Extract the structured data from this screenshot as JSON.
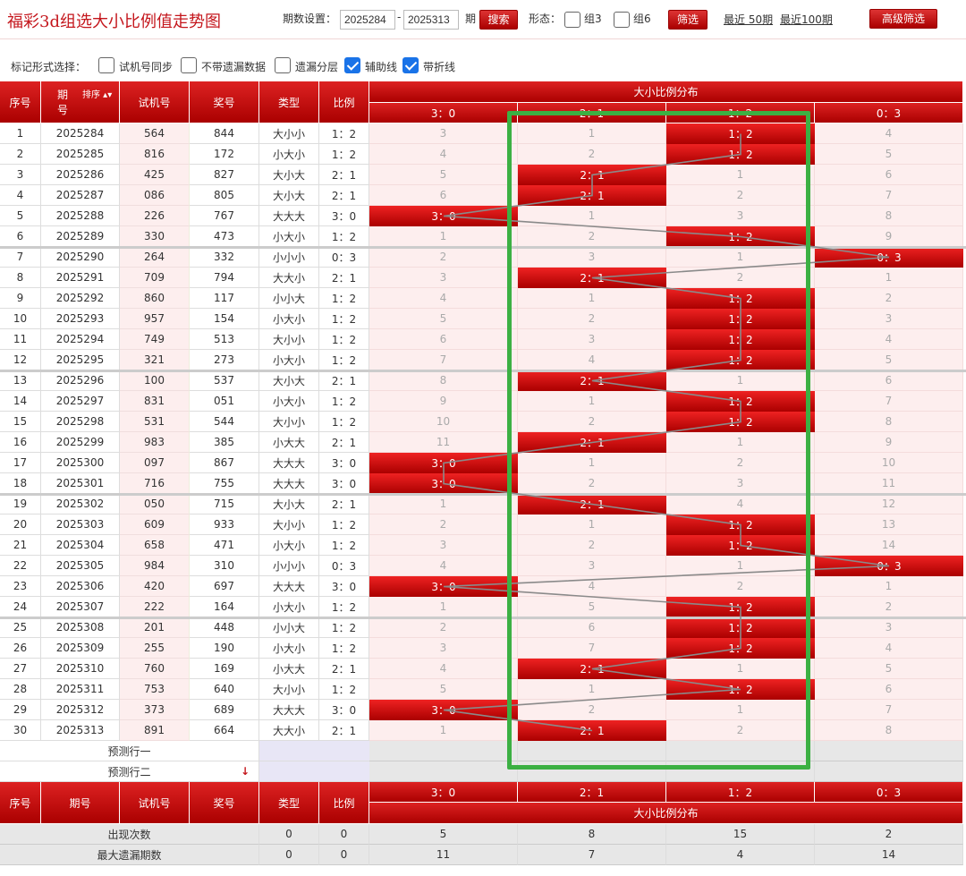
{
  "header": {
    "title": "福彩3d组选大小比例值走势图",
    "period_label": "期数设置：",
    "period_from": "2025284",
    "period_to": "2025313",
    "period_suffix": "期",
    "search_label": "搜索",
    "form_label": "形态：",
    "group3_label": "组3",
    "group6_label": "组6",
    "filter_label": "筛选",
    "recent50": "最近 50期",
    "recent100": "最近100期",
    "advanced_filter": "高级筛选"
  },
  "options": {
    "label": "标记形式选择：",
    "items": [
      {
        "label": "试机号同步",
        "checked": false
      },
      {
        "label": "不带遗漏数据",
        "checked": false
      },
      {
        "label": "遗漏分层",
        "checked": false
      },
      {
        "label": "辅助线",
        "checked": true
      },
      {
        "label": "带折线",
        "checked": true
      }
    ]
  },
  "table": {
    "headers": {
      "seq": "序号",
      "period_top": "期",
      "period_bottom": "号",
      "sort": "排序",
      "test_no": "试机号",
      "prize_no": "奖号",
      "type": "类型",
      "ratio": "比例",
      "group": "大小比例分布"
    },
    "ratio_columns": [
      "3：0",
      "2：1",
      "1：2",
      "0：3"
    ],
    "rows": [
      {
        "seq": "1",
        "period": "2025284",
        "test": "564",
        "prize": "844",
        "type": "大小小",
        "ratio": "1：2",
        "hit": 2,
        "miss": [
          "3",
          "1",
          "1：2",
          "4"
        ]
      },
      {
        "seq": "2",
        "period": "2025285",
        "test": "816",
        "prize": "172",
        "type": "小大小",
        "ratio": "1：2",
        "hit": 2,
        "miss": [
          "4",
          "2",
          "1：2",
          "5"
        ]
      },
      {
        "seq": "3",
        "period": "2025286",
        "test": "425",
        "prize": "827",
        "type": "大小大",
        "ratio": "2：1",
        "hit": 1,
        "miss": [
          "5",
          "2：1",
          "1",
          "6"
        ]
      },
      {
        "seq": "4",
        "period": "2025287",
        "test": "086",
        "prize": "805",
        "type": "大小大",
        "ratio": "2：1",
        "hit": 1,
        "miss": [
          "6",
          "2：1",
          "2",
          "7"
        ]
      },
      {
        "seq": "5",
        "period": "2025288",
        "test": "226",
        "prize": "767",
        "type": "大大大",
        "ratio": "3：0",
        "hit": 0,
        "miss": [
          "3：0",
          "1",
          "3",
          "8"
        ]
      },
      {
        "seq": "6",
        "period": "2025289",
        "test": "330",
        "prize": "473",
        "type": "小大小",
        "ratio": "1：2",
        "hit": 2,
        "miss": [
          "1",
          "2",
          "1：2",
          "9"
        ]
      },
      {
        "seq": "7",
        "period": "2025290",
        "test": "264",
        "prize": "332",
        "type": "小小小",
        "ratio": "0：3",
        "hit": 3,
        "miss": [
          "2",
          "3",
          "1",
          "0：3"
        ]
      },
      {
        "seq": "8",
        "period": "2025291",
        "test": "709",
        "prize": "794",
        "type": "大大小",
        "ratio": "2：1",
        "hit": 1,
        "miss": [
          "3",
          "2：1",
          "2",
          "1"
        ]
      },
      {
        "seq": "9",
        "period": "2025292",
        "test": "860",
        "prize": "117",
        "type": "小小大",
        "ratio": "1：2",
        "hit": 2,
        "miss": [
          "4",
          "1",
          "1：2",
          "2"
        ]
      },
      {
        "seq": "10",
        "period": "2025293",
        "test": "957",
        "prize": "154",
        "type": "小大小",
        "ratio": "1：2",
        "hit": 2,
        "miss": [
          "5",
          "2",
          "1：2",
          "3"
        ]
      },
      {
        "seq": "11",
        "period": "2025294",
        "test": "749",
        "prize": "513",
        "type": "大小小",
        "ratio": "1：2",
        "hit": 2,
        "miss": [
          "6",
          "3",
          "1：2",
          "4"
        ]
      },
      {
        "seq": "12",
        "period": "2025295",
        "test": "321",
        "prize": "273",
        "type": "小大小",
        "ratio": "1：2",
        "hit": 2,
        "miss": [
          "7",
          "4",
          "1：2",
          "5"
        ]
      },
      {
        "seq": "13",
        "period": "2025296",
        "test": "100",
        "prize": "537",
        "type": "大小大",
        "ratio": "2：1",
        "hit": 1,
        "miss": [
          "8",
          "2：1",
          "1",
          "6"
        ]
      },
      {
        "seq": "14",
        "period": "2025297",
        "test": "831",
        "prize": "051",
        "type": "小大小",
        "ratio": "1：2",
        "hit": 2,
        "miss": [
          "9",
          "1",
          "1：2",
          "7"
        ]
      },
      {
        "seq": "15",
        "period": "2025298",
        "test": "531",
        "prize": "544",
        "type": "大小小",
        "ratio": "1：2",
        "hit": 2,
        "miss": [
          "10",
          "2",
          "1：2",
          "8"
        ]
      },
      {
        "seq": "16",
        "period": "2025299",
        "test": "983",
        "prize": "385",
        "type": "小大大",
        "ratio": "2：1",
        "hit": 1,
        "miss": [
          "11",
          "2：1",
          "1",
          "9"
        ]
      },
      {
        "seq": "17",
        "period": "2025300",
        "test": "097",
        "prize": "867",
        "type": "大大大",
        "ratio": "3：0",
        "hit": 0,
        "miss": [
          "3：0",
          "1",
          "2",
          "10"
        ]
      },
      {
        "seq": "18",
        "period": "2025301",
        "test": "716",
        "prize": "755",
        "type": "大大大",
        "ratio": "3：0",
        "hit": 0,
        "miss": [
          "3：0",
          "2",
          "3",
          "11"
        ]
      },
      {
        "seq": "19",
        "period": "2025302",
        "test": "050",
        "prize": "715",
        "type": "大小大",
        "ratio": "2：1",
        "hit": 1,
        "miss": [
          "1",
          "2：1",
          "4",
          "12"
        ]
      },
      {
        "seq": "20",
        "period": "2025303",
        "test": "609",
        "prize": "933",
        "type": "大小小",
        "ratio": "1：2",
        "hit": 2,
        "miss": [
          "2",
          "1",
          "1：2",
          "13"
        ]
      },
      {
        "seq": "21",
        "period": "2025304",
        "test": "658",
        "prize": "471",
        "type": "小大小",
        "ratio": "1：2",
        "hit": 2,
        "miss": [
          "3",
          "2",
          "1：2",
          "14"
        ]
      },
      {
        "seq": "22",
        "period": "2025305",
        "test": "984",
        "prize": "310",
        "type": "小小小",
        "ratio": "0：3",
        "hit": 3,
        "miss": [
          "4",
          "3",
          "1",
          "0：3"
        ]
      },
      {
        "seq": "23",
        "period": "2025306",
        "test": "420",
        "prize": "697",
        "type": "大大大",
        "ratio": "3：0",
        "hit": 0,
        "miss": [
          "3：0",
          "4",
          "2",
          "1"
        ]
      },
      {
        "seq": "24",
        "period": "2025307",
        "test": "222",
        "prize": "164",
        "type": "小大小",
        "ratio": "1：2",
        "hit": 2,
        "miss": [
          "1",
          "5",
          "1：2",
          "2"
        ]
      },
      {
        "seq": "25",
        "period": "2025308",
        "test": "201",
        "prize": "448",
        "type": "小小大",
        "ratio": "1：2",
        "hit": 2,
        "miss": [
          "2",
          "6",
          "1：2",
          "3"
        ]
      },
      {
        "seq": "26",
        "period": "2025309",
        "test": "255",
        "prize": "190",
        "type": "小大小",
        "ratio": "1：2",
        "hit": 2,
        "miss": [
          "3",
          "7",
          "1：2",
          "4"
        ]
      },
      {
        "seq": "27",
        "period": "2025310",
        "test": "760",
        "prize": "169",
        "type": "小大大",
        "ratio": "2：1",
        "hit": 1,
        "miss": [
          "4",
          "2：1",
          "1",
          "5"
        ]
      },
      {
        "seq": "28",
        "period": "2025311",
        "test": "753",
        "prize": "640",
        "type": "大小小",
        "ratio": "1：2",
        "hit": 2,
        "miss": [
          "5",
          "1",
          "1：2",
          "6"
        ]
      },
      {
        "seq": "29",
        "period": "2025312",
        "test": "373",
        "prize": "689",
        "type": "大大大",
        "ratio": "3：0",
        "hit": 0,
        "miss": [
          "3：0",
          "2",
          "1",
          "7"
        ]
      },
      {
        "seq": "30",
        "period": "2025313",
        "test": "891",
        "prize": "664",
        "type": "大大小",
        "ratio": "2：1",
        "hit": 1,
        "miss": [
          "1",
          "2：1",
          "2",
          "8"
        ]
      }
    ],
    "predict_rows": [
      "预测行一",
      "预测行二"
    ],
    "stats": [
      {
        "label": "出现次数",
        "type": "0",
        "ratio": "0",
        "values": [
          "5",
          "8",
          "15",
          "2"
        ]
      },
      {
        "label": "最大遗漏期数",
        "type": "0",
        "ratio": "0",
        "values": [
          "11",
          "7",
          "4",
          "14"
        ]
      }
    ]
  },
  "colors": {
    "accent": "#c4161c",
    "highlight_box": "#3cb043",
    "checkbox_on": "#1a73e8"
  }
}
